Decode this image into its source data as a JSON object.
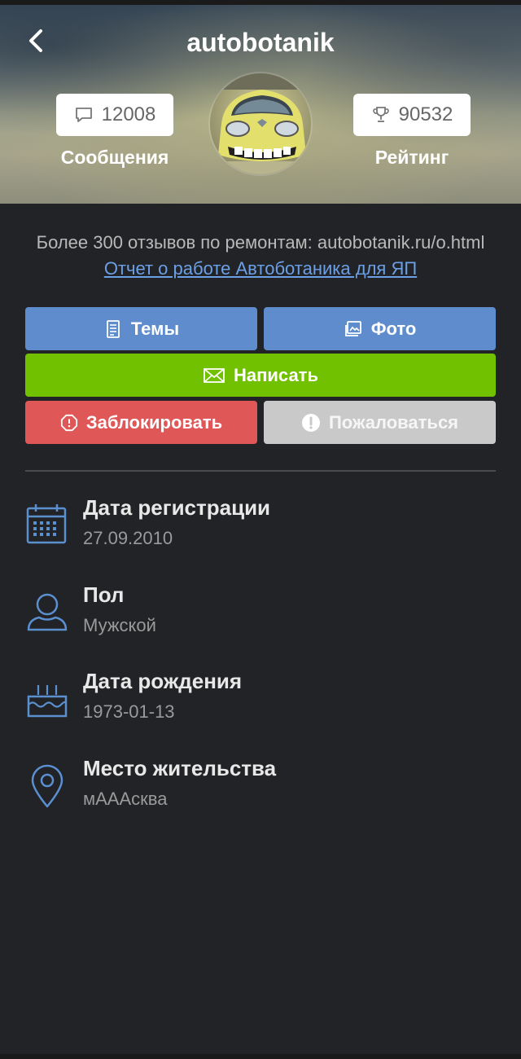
{
  "profile": {
    "username": "autobotanik",
    "messages_count": "12008",
    "messages_label": "Сообщения",
    "rating_value": "90532",
    "rating_label": "Рейтинг"
  },
  "about": {
    "text": "Более 300 отзывов по ремонтам: autobotanik.ru/o.html",
    "link_text": " Отчет о работе Автоботаника для ЯП"
  },
  "actions": {
    "topics_label": "Темы",
    "photo_label": "Фото",
    "write_label": "Написать",
    "block_label": "Заблокировать",
    "report_label": "Пожаловаться"
  },
  "info": [
    {
      "title": "Дата регистрации",
      "value": "27.09.2010",
      "icon": "calendar-icon"
    },
    {
      "title": "Пол",
      "value": "Мужской",
      "icon": "user-icon"
    },
    {
      "title": "Дата рождения",
      "value": "1973-01-13",
      "icon": "birthday-cake-icon"
    },
    {
      "title": "Место жительства",
      "value": "мАААсква",
      "icon": "location-pin-icon"
    }
  ],
  "colors": {
    "background": "#222326",
    "blue_button": "#5f8ccc",
    "green_button": "#72c100",
    "red_button": "#e05757",
    "gray_button": "#c9c9c9",
    "icon_blue": "#5a8fd0",
    "link": "#6ba0e6"
  }
}
